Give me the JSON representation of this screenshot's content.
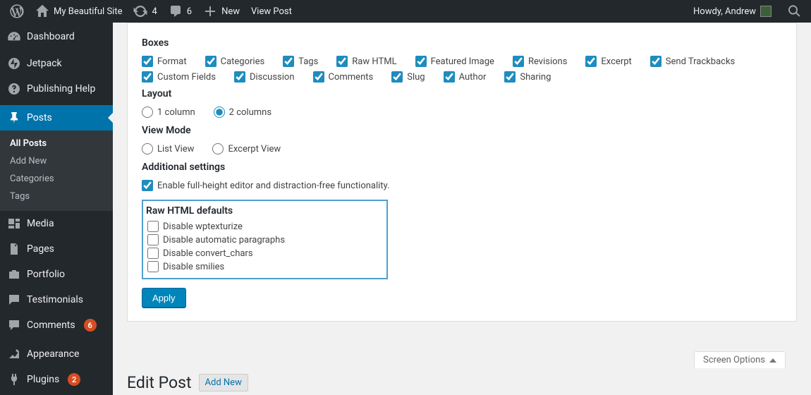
{
  "adminbar": {
    "site_name": "My Beautiful Site",
    "updates_count": "4",
    "comments_count": "6",
    "new_label": "New",
    "view_post_label": "View Post",
    "howdy": "Howdy, Andrew"
  },
  "sidebar": {
    "dashboard": "Dashboard",
    "jetpack": "Jetpack",
    "publishing_help": "Publishing Help",
    "posts": "Posts",
    "posts_sub": [
      "All Posts",
      "Add New",
      "Categories",
      "Tags"
    ],
    "media": "Media",
    "pages": "Pages",
    "portfolio": "Portfolio",
    "testimonials": "Testimonials",
    "comments": "Comments",
    "comments_count": "6",
    "appearance": "Appearance",
    "plugins": "Plugins",
    "plugins_count": "2"
  },
  "options": {
    "boxes_title": "Boxes",
    "boxes": [
      "Format",
      "Categories",
      "Tags",
      "Raw HTML",
      "Featured Image",
      "Revisions",
      "Excerpt",
      "Send Trackbacks",
      "Custom Fields",
      "Discussion",
      "Comments",
      "Slug",
      "Author",
      "Sharing"
    ],
    "layout_title": "Layout",
    "layout_options": [
      "1 column",
      "2 columns"
    ],
    "view_mode_title": "View Mode",
    "view_mode_options": [
      "List View",
      "Excerpt View"
    ],
    "additional_title": "Additional settings",
    "additional_label": "Enable full-height editor and distraction-free functionality.",
    "raw_title": "Raw HTML defaults",
    "raw_options": [
      "Disable wptexturize",
      "Disable automatic paragraphs",
      "Disable convert_chars",
      "Disable smilies"
    ],
    "apply_label": "Apply"
  },
  "screen_options_label": "Screen Options",
  "page_heading": "Edit Post",
  "page_action": "Add New"
}
